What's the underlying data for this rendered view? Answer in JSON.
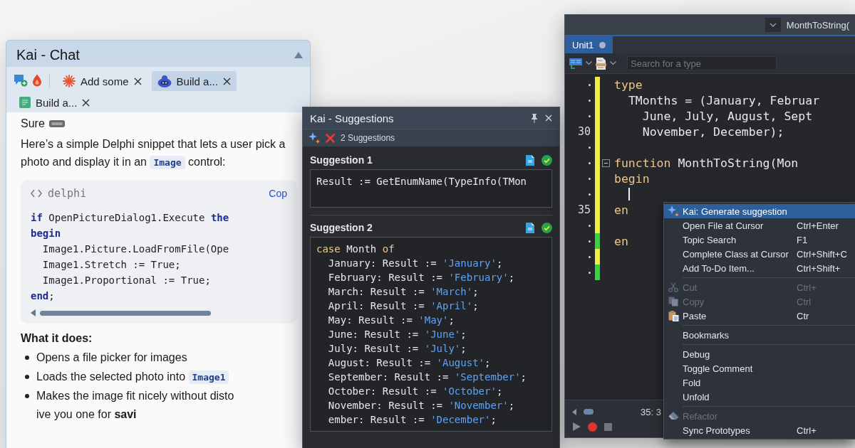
{
  "chat": {
    "title": "Kai - Chat",
    "tab_rows": [
      [
        {
          "label": "Add some",
          "selected": false
        },
        {
          "label": "Build a...",
          "selected": true
        }
      ],
      [
        {
          "label": "Build a...",
          "selected": false
        }
      ]
    ],
    "greeting": "Sure",
    "intro": [
      {
        "kind": "text",
        "text": "Here’s a simple Delphi snippet that lets a user pick a photo and display it in an"
      },
      {
        "kind": "code",
        "text": "Image"
      },
      {
        "kind": "text",
        "text": "control:"
      }
    ],
    "code_block": {
      "language": "delphi",
      "copy_link": "Cop",
      "lines": [
        [
          {
            "kind": "keyword",
            "text": "if"
          },
          {
            "kind": "plain",
            "text": " OpenPictureDialog1.Execute "
          },
          {
            "kind": "keyword",
            "text": "the"
          }
        ],
        [
          {
            "kind": "keyword",
            "text": "begin"
          }
        ],
        [
          {
            "kind": "plain",
            "text": "  Image1.Picture.LoadFromFile(Ope"
          }
        ],
        [
          {
            "kind": "plain",
            "text": "  Image1.Stretch := True;"
          }
        ],
        [
          {
            "kind": "plain",
            "text": "  Image1.Proportional := True;"
          }
        ],
        [
          {
            "kind": "keyword",
            "text": "end"
          },
          {
            "kind": "plain",
            "text": ";"
          }
        ]
      ]
    },
    "heading": "What it does:",
    "bullets": [
      [
        {
          "kind": "text",
          "text": "Opens a file picker for images"
        }
      ],
      [
        {
          "kind": "text",
          "text": "Loads the selected photo into"
        },
        {
          "kind": "code",
          "text": "Image1"
        }
      ],
      [
        {
          "kind": "text",
          "text": "Makes the image fit nicely without disto"
        }
      ]
    ],
    "trailing": "ive you one for **savi**"
  },
  "suggestions": {
    "title": "Kai - Suggestions",
    "count": "2 Suggestions",
    "items": [
      {
        "heading": "Suggestion 1",
        "lines": [
          [
            {
              "kind": "plain",
              "text": "Result := GetEnumName(TypeInfo(TMon"
            }
          ]
        ]
      },
      {
        "heading": "Suggestion 2",
        "lines": [
          [
            {
              "kind": "keyword",
              "text": "case"
            },
            {
              "kind": "plain",
              "text": " Month "
            },
            {
              "kind": "keyword",
              "text": "of"
            }
          ],
          [
            {
              "kind": "plain",
              "text": "  January: Result := "
            },
            {
              "kind": "string",
              "text": "'January'"
            },
            {
              "kind": "plain",
              "text": ";"
            }
          ],
          [
            {
              "kind": "plain",
              "text": "  February: Result := "
            },
            {
              "kind": "string",
              "text": "'February'"
            },
            {
              "kind": "plain",
              "text": ";"
            }
          ],
          [
            {
              "kind": "plain",
              "text": "  March: Result := "
            },
            {
              "kind": "string",
              "text": "'March'"
            },
            {
              "kind": "plain",
              "text": ";"
            }
          ],
          [
            {
              "kind": "plain",
              "text": "  April: Result := "
            },
            {
              "kind": "string",
              "text": "'April'"
            },
            {
              "kind": "plain",
              "text": ";"
            }
          ],
          [
            {
              "kind": "plain",
              "text": "  May: Result := "
            },
            {
              "kind": "string",
              "text": "'May'"
            },
            {
              "kind": "plain",
              "text": ";"
            }
          ],
          [
            {
              "kind": "plain",
              "text": "  June: Result := "
            },
            {
              "kind": "string",
              "text": "'June'"
            },
            {
              "kind": "plain",
              "text": ";"
            }
          ],
          [
            {
              "kind": "plain",
              "text": "  July: Result := "
            },
            {
              "kind": "string",
              "text": "'July'"
            },
            {
              "kind": "plain",
              "text": ";"
            }
          ],
          [
            {
              "kind": "plain",
              "text": "  August: Result := "
            },
            {
              "kind": "string",
              "text": "'August'"
            },
            {
              "kind": "plain",
              "text": ";"
            }
          ],
          [
            {
              "kind": "plain",
              "text": "  September: Result := "
            },
            {
              "kind": "string",
              "text": "'September'"
            },
            {
              "kind": "plain",
              "text": ";"
            }
          ],
          [
            {
              "kind": "plain",
              "text": "  October: Result := "
            },
            {
              "kind": "string",
              "text": "'October'"
            },
            {
              "kind": "plain",
              "text": ";"
            }
          ],
          [
            {
              "kind": "plain",
              "text": "  November: Result := "
            },
            {
              "kind": "string",
              "text": "'November'"
            },
            {
              "kind": "plain",
              "text": ";"
            }
          ],
          [
            {
              "kind": "plain",
              "text": "  ember: Result := "
            },
            {
              "kind": "string",
              "text": "'December'"
            },
            {
              "kind": "plain",
              "text": ";"
            }
          ]
        ]
      }
    ]
  },
  "editor": {
    "breadcrumb": "MonthToString(",
    "tabs": [
      {
        "label": "Unit1",
        "selected": true,
        "modified": true
      }
    ],
    "search": {
      "placeholder": "Search for a type"
    },
    "lines": [
      {
        "tokens": [
          {
            "kind": "keyword",
            "text": "type"
          }
        ],
        "color": "#f1ed3a",
        "foldable": false,
        "cursor": false
      },
      {
        "tokens": [
          {
            "kind": "plain",
            "text": "  TMonths = (January, Februar"
          }
        ],
        "color": "#f1ed3a",
        "foldable": false,
        "cursor": false
      },
      {
        "tokens": [
          {
            "kind": "plain",
            "text": "    June, July, August, Sept"
          }
        ],
        "color": "#f1ed3a",
        "foldable": false,
        "cursor": false
      },
      {
        "number": "30",
        "tokens": [
          {
            "kind": "plain",
            "text": "    November, December);"
          }
        ],
        "color": "#f1ed3a",
        "foldable": false,
        "cursor": false
      },
      {
        "color": "#f1ed3a",
        "foldable": false,
        "cursor": false
      },
      {
        "tokens": [
          {
            "kind": "keyword",
            "text": "function"
          },
          {
            "kind": "plain",
            "text": " MonthToString(Mon"
          }
        ],
        "color": "#f1ed3a",
        "foldable": true,
        "cursor": false
      },
      {
        "tokens": [
          {
            "kind": "keyword",
            "text": "begin"
          }
        ],
        "color": "#f1ed3a",
        "foldable": false,
        "cursor": false
      },
      {
        "color": "#f1ed3a",
        "foldable": false,
        "cursor": true
      },
      {
        "number": "35",
        "tokens": [
          {
            "kind": "keyword",
            "text": "en"
          }
        ],
        "color": "#f1ed3a",
        "foldable": false,
        "cursor": false
      },
      {
        "color": "#f1ed3a",
        "foldable": false,
        "cursor": false
      },
      {
        "tokens": [
          {
            "kind": "keyword",
            "text": "en"
          }
        ],
        "color": "#36d33c",
        "foldable": false,
        "cursor": false
      },
      {
        "color": "#f1ed3a",
        "foldable": false,
        "cursor": false
      },
      {
        "color": "#36d33c",
        "foldable": false,
        "cursor": false
      }
    ],
    "status_bar": {
      "position": "35: 3"
    }
  },
  "context_menu": {
    "groups": [
      [
        {
          "label": "Kai: Generate suggestion",
          "selected": true,
          "disabled": false
        },
        {
          "label": "Open File at Cursor",
          "shortcut": "Ctrl+Enter",
          "selected": false,
          "disabled": false
        },
        {
          "label": "Topic Search",
          "shortcut": "F1",
          "selected": false,
          "disabled": false
        },
        {
          "label": "Complete Class at Cursor",
          "shortcut": "Ctrl+Shift+C",
          "selected": false,
          "disabled": false
        },
        {
          "label": "Add To-Do Item...",
          "shortcut": "Ctrl+Shift+",
          "selected": false,
          "disabled": false
        }
      ],
      [
        {
          "label": "Cut",
          "shortcut": "Ctrl+",
          "selected": false,
          "disabled": true
        },
        {
          "label": "Copy",
          "shortcut": "Ctrl",
          "selected": false,
          "disabled": true
        },
        {
          "label": "Paste",
          "shortcut": "Ctr",
          "selected": false,
          "disabled": false
        }
      ],
      [
        {
          "label": "Bookmarks",
          "selected": false,
          "disabled": false
        }
      ],
      [
        {
          "label": "Debug",
          "selected": false,
          "disabled": false
        },
        {
          "label": "Toggle Comment",
          "selected": false,
          "disabled": false
        },
        {
          "label": "Fold",
          "selected": false,
          "disabled": false
        },
        {
          "label": "Unfold",
          "selected": false,
          "disabled": false
        }
      ],
      [
        {
          "label": "Refactor",
          "selected": false,
          "disabled": true
        },
        {
          "label": "Sync Prototypes",
          "shortcut": "Ctrl+",
          "selected": false,
          "disabled": false
        }
      ]
    ]
  }
}
